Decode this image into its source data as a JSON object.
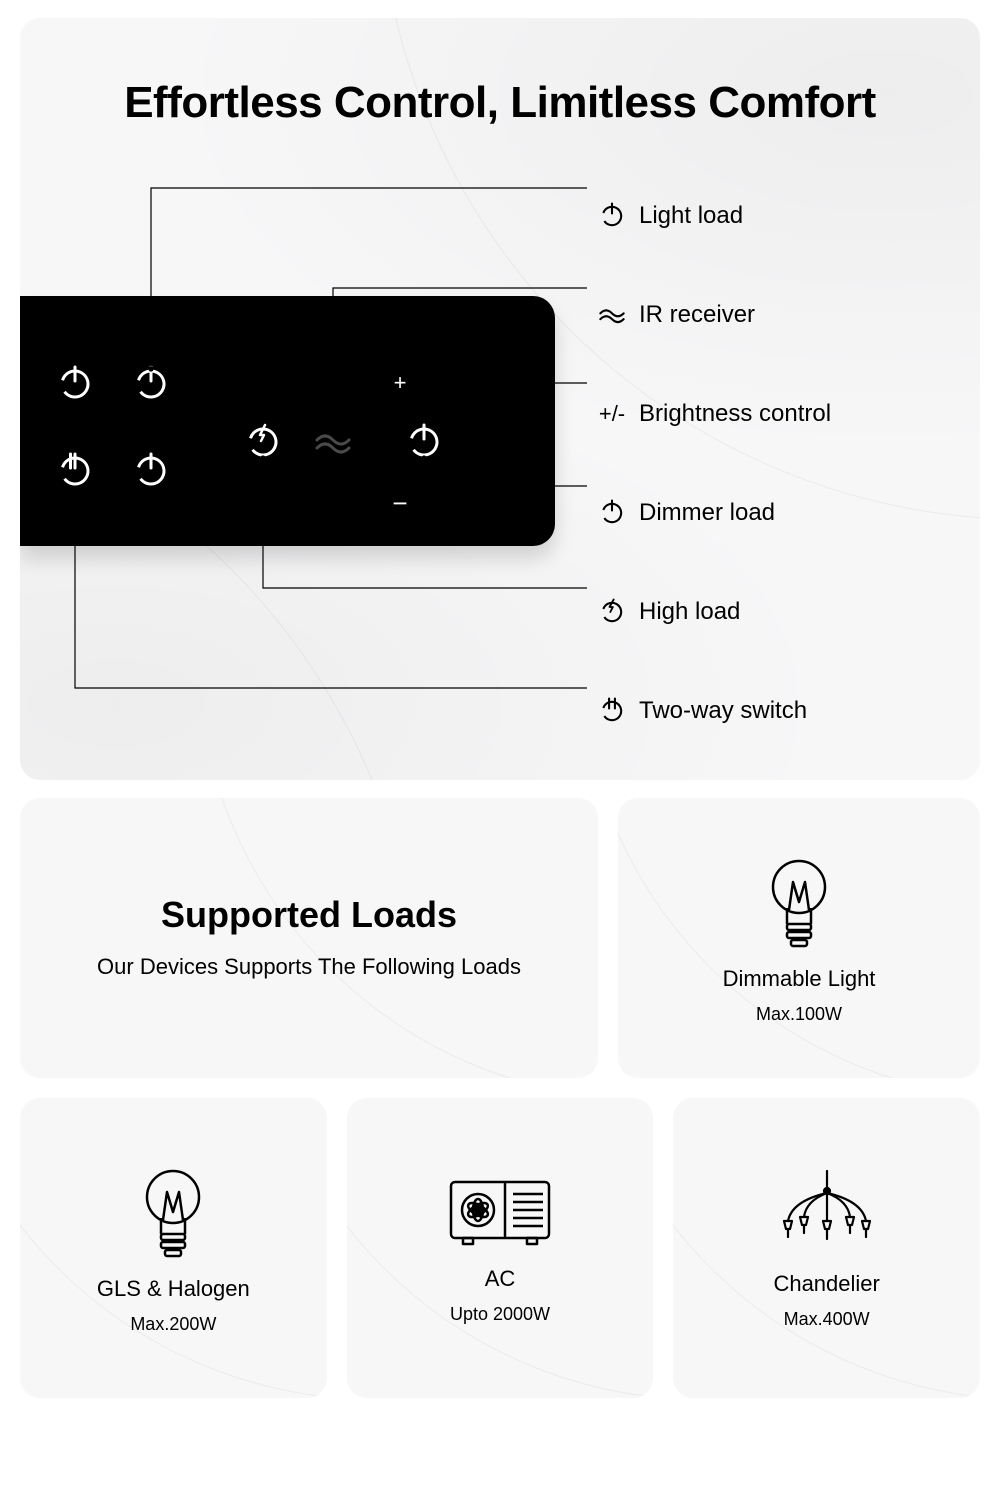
{
  "hero": {
    "title": "Effortless Control, Limitless Comfort",
    "callouts": [
      {
        "icon": "power",
        "label": "Light load"
      },
      {
        "icon": "ir",
        "label": "IR receiver"
      },
      {
        "icon": "plusminus",
        "label": "Brightness control"
      },
      {
        "icon": "power",
        "label": "Dimmer load"
      },
      {
        "icon": "bolt",
        "label": "High load"
      },
      {
        "icon": "twoway",
        "label": "Two-way switch"
      }
    ]
  },
  "supportedLoads": {
    "title": "Supported Loads",
    "subtitle": "Our Devices Supports The Following Loads",
    "items": [
      {
        "icon": "bulb",
        "label": "Dimmable Light",
        "capacity": "Max.100W"
      },
      {
        "icon": "bulb",
        "label": "GLS & Halogen",
        "capacity": "Max.200W"
      },
      {
        "icon": "ac",
        "label": "AC",
        "capacity": "Upto 2000W"
      },
      {
        "icon": "chandelier",
        "label": "Chandelier",
        "capacity": "Max.400W"
      }
    ]
  }
}
